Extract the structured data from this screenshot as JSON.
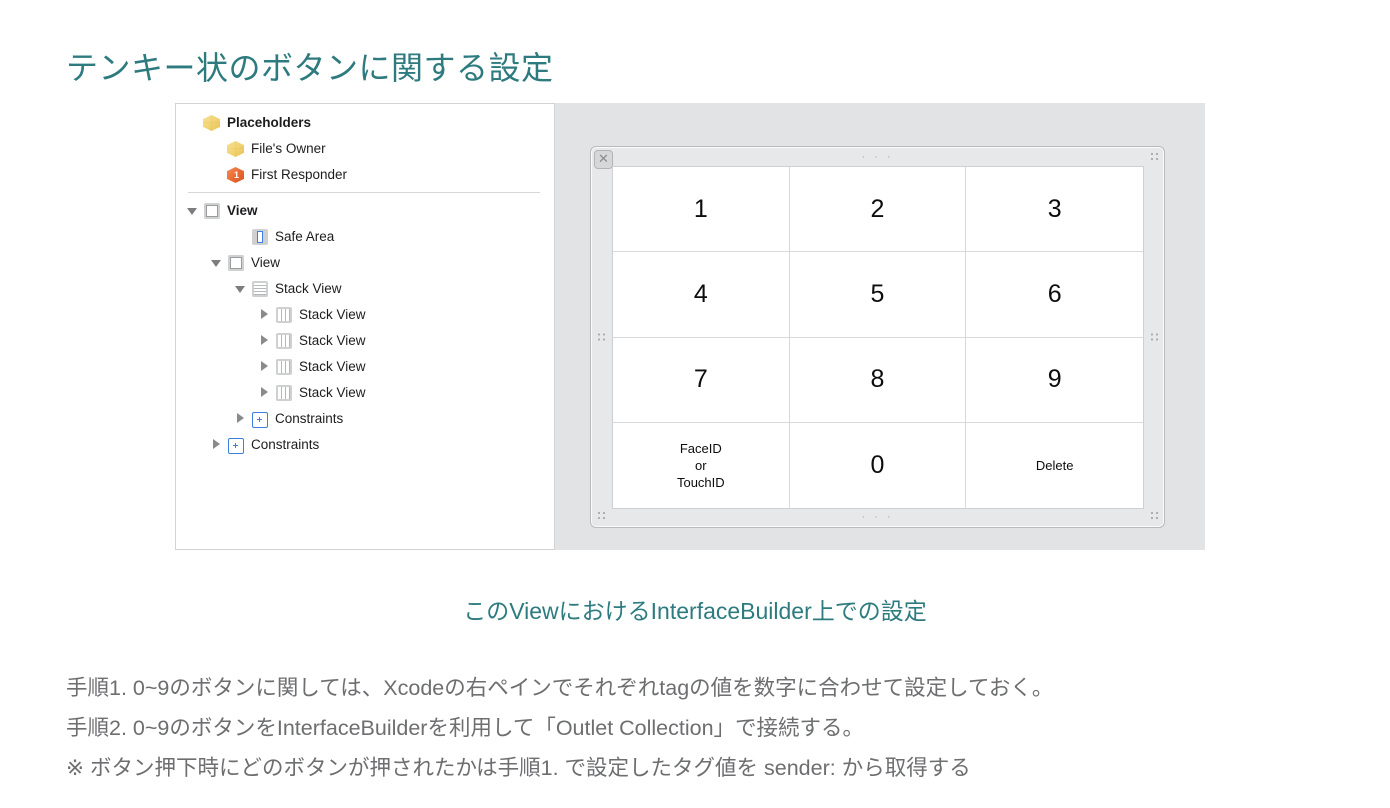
{
  "slide": {
    "title": "テンキー状のボタンに関する設定",
    "title_color": "#2e7b7f",
    "body_color": "#6d6e70",
    "background": "#ffffff"
  },
  "figure": {
    "caption": "このViewにおけるInterfaceBuilder上での設定",
    "caption_color": "#2e7b7f",
    "canvas_background": "#e2e3e5"
  },
  "outline": {
    "panel_name": "document-outline",
    "separator_after_index": 2,
    "rows": [
      {
        "label": "Placeholders",
        "indent": 0,
        "disclosure": "none",
        "icon": "cube-yellow-icon",
        "bold": true
      },
      {
        "label": "File's Owner",
        "indent": 1,
        "disclosure": "none",
        "icon": "cube-yellow-icon",
        "bold": false
      },
      {
        "label": "First Responder",
        "indent": 1,
        "disclosure": "none",
        "icon": "cube-orange-icon",
        "bold": false,
        "badge": "1"
      },
      {
        "label": "View",
        "indent": 0,
        "disclosure": "open",
        "icon": "view-icon",
        "bold": true
      },
      {
        "label": "Safe Area",
        "indent": 2,
        "disclosure": "none",
        "icon": "safe-area-icon",
        "bold": false
      },
      {
        "label": "View",
        "indent": 1,
        "disclosure": "open",
        "icon": "view-icon",
        "bold": false
      },
      {
        "label": "Stack View",
        "indent": 2,
        "disclosure": "open",
        "icon": "stack-view-vertical-icon",
        "bold": false
      },
      {
        "label": "Stack View",
        "indent": 3,
        "disclosure": "closed",
        "icon": "stack-view-horizontal-icon",
        "bold": false
      },
      {
        "label": "Stack View",
        "indent": 3,
        "disclosure": "closed",
        "icon": "stack-view-horizontal-icon",
        "bold": false
      },
      {
        "label": "Stack View",
        "indent": 3,
        "disclosure": "closed",
        "icon": "stack-view-horizontal-icon",
        "bold": false
      },
      {
        "label": "Stack View",
        "indent": 3,
        "disclosure": "closed",
        "icon": "stack-view-horizontal-icon",
        "bold": false
      },
      {
        "label": "Constraints",
        "indent": 2,
        "disclosure": "closed",
        "icon": "constraints-icon",
        "bold": false
      },
      {
        "label": "Constraints",
        "indent": 1,
        "disclosure": "closed",
        "icon": "constraints-icon",
        "bold": false
      }
    ]
  },
  "device": {
    "close_button_label": "✕",
    "keypad": {
      "columns": 3,
      "rows": 4,
      "keys": [
        {
          "label": "1",
          "type": "num",
          "tag": "1"
        },
        {
          "label": "2",
          "type": "num",
          "tag": "2"
        },
        {
          "label": "3",
          "type": "num",
          "tag": "3"
        },
        {
          "label": "4",
          "type": "num",
          "tag": "4"
        },
        {
          "label": "5",
          "type": "num",
          "tag": "5"
        },
        {
          "label": "6",
          "type": "num",
          "tag": "6"
        },
        {
          "label": "7",
          "type": "num",
          "tag": "7"
        },
        {
          "label": "8",
          "type": "num",
          "tag": "8"
        },
        {
          "label": "9",
          "type": "num",
          "tag": "9"
        },
        {
          "label": "FaceID\nor\nTouchID",
          "type": "word",
          "tag": ""
        },
        {
          "label": "0",
          "type": "num",
          "tag": "0"
        },
        {
          "label": "Delete",
          "type": "word",
          "tag": ""
        }
      ]
    }
  },
  "body": {
    "lines": [
      "手順1. 0~9のボタンに関しては、Xcodeの右ペインでそれぞれtagの値を数字に合わせて設定しておく。",
      "手順2. 0~9のボタンをInterfaceBuilderを利用して「Outlet Collection」で接続する。",
      "※ ボタン押下時にどのボタンが押されたかは手順1. で設定したタグ値を sender: から取得する"
    ]
  }
}
